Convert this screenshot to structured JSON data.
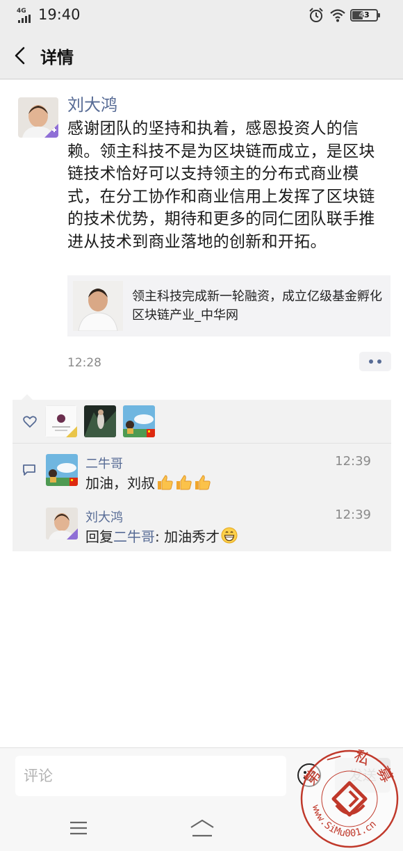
{
  "status_bar": {
    "network": "4G",
    "time": "19:40",
    "battery_level": "43",
    "battery_fraction": 0.43,
    "icons": [
      "signal-icon",
      "alarm-icon",
      "wifi-icon",
      "battery-icon"
    ]
  },
  "nav": {
    "back_icon": "chevron-left-icon",
    "title": "详情"
  },
  "post": {
    "author": "刘大鸿",
    "text": "感谢团队的坚持和执着，感恩投资人的信赖。领主科技不是为区块链而成立，是区块链技术恰好可以支持领主的分布式商业模式，在分工协作和商业信用上发挥了区块链的技术优势，期待和更多的同仁团队联手推进从技术到商业落地的创新和开拓。",
    "link": {
      "title": "领主科技完成新一轮融资，成立亿级基金孵化区块链产业_中华网"
    },
    "time": "12:28",
    "more_icon": "more-dots-icon"
  },
  "likes": {
    "icon": "heart-icon",
    "count": 3
  },
  "comments": [
    {
      "author": "二牛哥",
      "time": "12:39",
      "text": "加油，刘叔",
      "emoji": [
        "thumbs-up",
        "thumbs-up",
        "thumbs-up"
      ]
    },
    {
      "author": "刘大鸿",
      "time": "12:39",
      "reply_prefix": "回复",
      "reply_to": "二牛哥",
      "text": ": 加油秀才",
      "emoji": [
        "grinning-face"
      ]
    }
  ],
  "input": {
    "placeholder": "评论",
    "send_label": "发送",
    "emoji_icon": "smiley-icon"
  },
  "system_nav": {
    "icons": [
      "menu-icon",
      "home-icon"
    ]
  },
  "watermark": {
    "text": "第一私募 www.SiMu001.cn",
    "color": "#c0392b"
  },
  "colors": {
    "link_blue": "#576b95",
    "background": "#ededed",
    "panel": "#f2f2f2"
  }
}
